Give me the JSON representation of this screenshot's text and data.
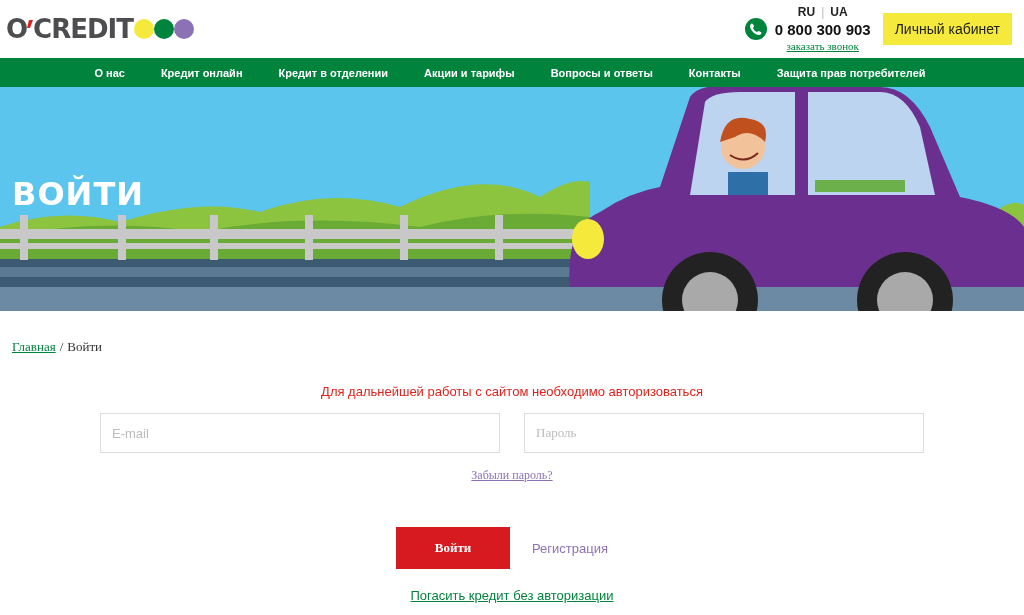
{
  "header": {
    "logo": {
      "left": "O",
      "right": "CREDIT",
      "dots": [
        {
          "color": "#f5ea3b"
        },
        {
          "color": "#00843d"
        },
        {
          "color": "#8c72b5"
        }
      ]
    },
    "languages": [
      "RU",
      "UA"
    ],
    "language_separator": "|",
    "phone": "0 800 300 903",
    "callback_link": "заказать звонок",
    "account_button": "Личный кабинет"
  },
  "nav": [
    "О нас",
    "Кредит онлайн",
    "Кредит в отделении",
    "Акции и тарифы",
    "Вопросы и ответы",
    "Контакты",
    "Защита прав потребителей"
  ],
  "hero": {
    "title": "ВОЙТИ"
  },
  "breadcrumb": {
    "home": "Главная",
    "separator": "/",
    "current": "Войти"
  },
  "login": {
    "notice": "Для дальнейшей работы с сайтом необходимо авторизоваться",
    "email": {
      "placeholder": "E-mail"
    },
    "password": {
      "placeholder": "Пароль"
    },
    "forgot_link": "Забыли пароль?",
    "submit_button": "Войти",
    "register_link": "Регистрация",
    "repay_link": "Погасить кредит без авторизации"
  }
}
